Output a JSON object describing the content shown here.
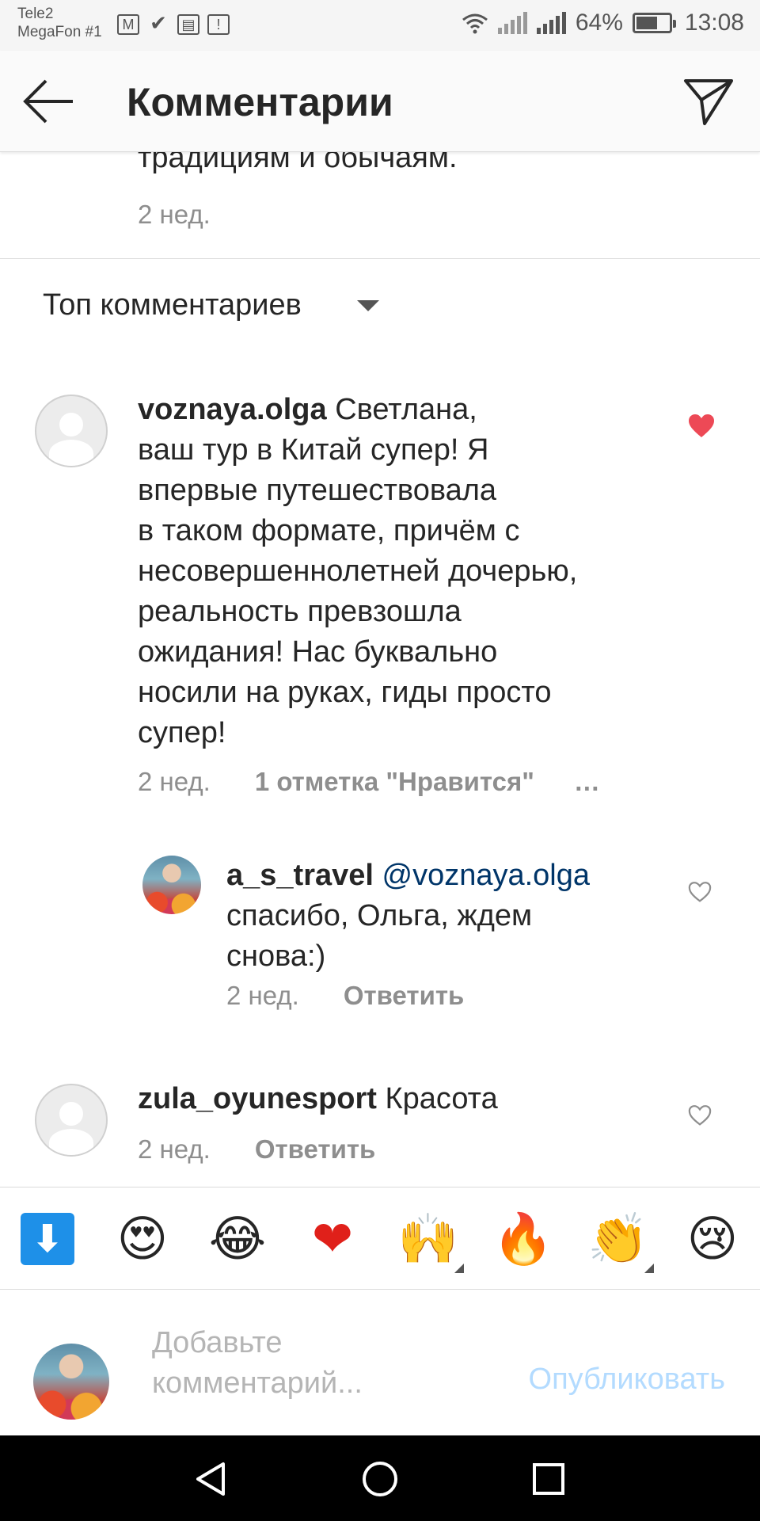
{
  "status_bar": {
    "carrier_1": "Tele2",
    "carrier_2": "MegaFon #1",
    "battery_percent": "64%",
    "battery_level": 0.64,
    "time": "13:08",
    "notification_icons": [
      "mail-icon",
      "check-icon",
      "calendar-icon",
      "image-alert-icon"
    ]
  },
  "header": {
    "title": "Комментарии"
  },
  "previous_comment": {
    "text_tail": "традициям и обычаям.",
    "time": "2 нед."
  },
  "sort": {
    "label": "Топ комментариев"
  },
  "comments": [
    {
      "username": "voznaya.olga",
      "text_first": " Светлана,",
      "text_lines": [
        "ваш тур в Китай супер! Я",
        "впервые путешествовала",
        "в таком формате, причём с",
        "несовершеннолетней дочерью,",
        "реальность превзошла",
        "ожидания! Нас буквально",
        "носили на руках, гиды просто",
        "супер!"
      ],
      "time": "2 нед.",
      "likes": "1 отметка \"Нравится\"",
      "more": "…",
      "liked": true
    },
    {
      "username": "a_s_travel",
      "mention": "@voznaya.olga",
      "text_lines": [
        "спасибо, Ольга, ждем",
        "снова:)"
      ],
      "time": "2 нед.",
      "reply": "Ответить",
      "liked": false
    },
    {
      "username": "zula_oyunesport",
      "text_first": " Красота",
      "time": "2 нед.",
      "reply": "Ответить",
      "liked": false
    }
  ],
  "emoji_bar": [
    "⬇",
    "😍",
    "😂",
    "❤",
    "🙌",
    "🔥",
    "👏",
    "😢"
  ],
  "input": {
    "placeholder_line1": "Добавьте",
    "placeholder_line2": "комментарий...",
    "publish": "Опубликовать"
  },
  "colors": {
    "liked_heart": "#ed4956",
    "mention": "#003569",
    "publish_disabled": "#b3dbff",
    "secondary_text": "#8e8e8e"
  }
}
